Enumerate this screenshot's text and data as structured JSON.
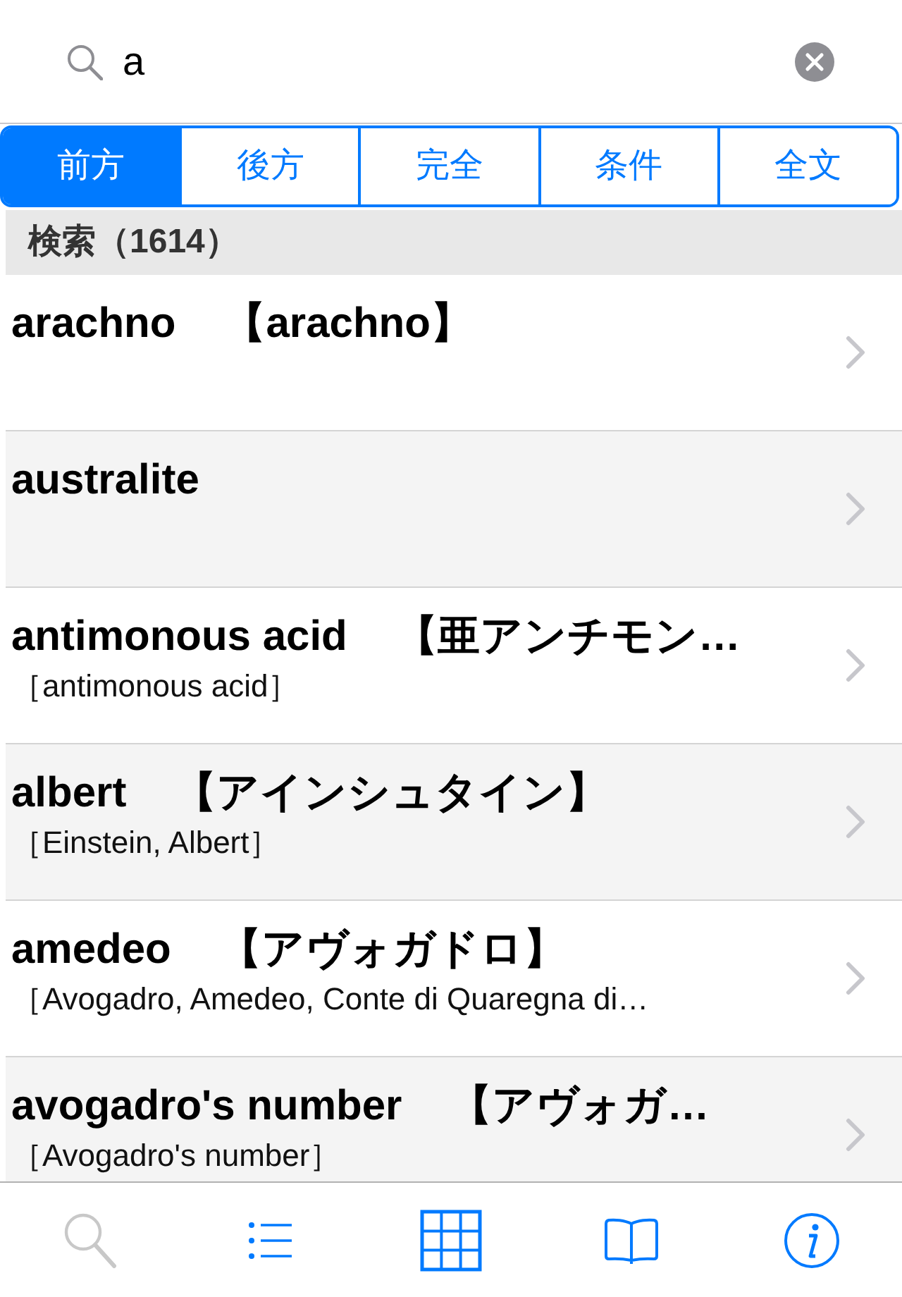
{
  "search": {
    "value": "a"
  },
  "segments": [
    {
      "label": "前方",
      "selected": true
    },
    {
      "label": "後方",
      "selected": false
    },
    {
      "label": "完全",
      "selected": false
    },
    {
      "label": "条件",
      "selected": false
    },
    {
      "label": "全文",
      "selected": false
    }
  ],
  "section_header": "検索（1614）",
  "results": [
    {
      "term": "arachno",
      "reading": "【arachno】"
    },
    {
      "term": "australite"
    },
    {
      "term": "antimonous acid",
      "reading": "【亜アンチモン…",
      "subtitle": "［antimonous acid］"
    },
    {
      "term": "albert",
      "reading": "【アインシュタイン】",
      "subtitle": "［Einstein, Albert］"
    },
    {
      "term": "amedeo",
      "reading": "【アヴォガドロ】",
      "subtitle": "［Avogadro, Amedeo, Conte di Quaregna di…"
    },
    {
      "term": "avogadro's number",
      "reading": "【アヴォガ…",
      "subtitle": "［Avogadro's number］"
    }
  ],
  "tab_bar": [
    {
      "kind": "search",
      "disabled": true
    },
    {
      "kind": "list",
      "disabled": false
    },
    {
      "kind": "grid",
      "disabled": false
    },
    {
      "kind": "book",
      "disabled": false
    },
    {
      "kind": "info",
      "disabled": false
    }
  ]
}
